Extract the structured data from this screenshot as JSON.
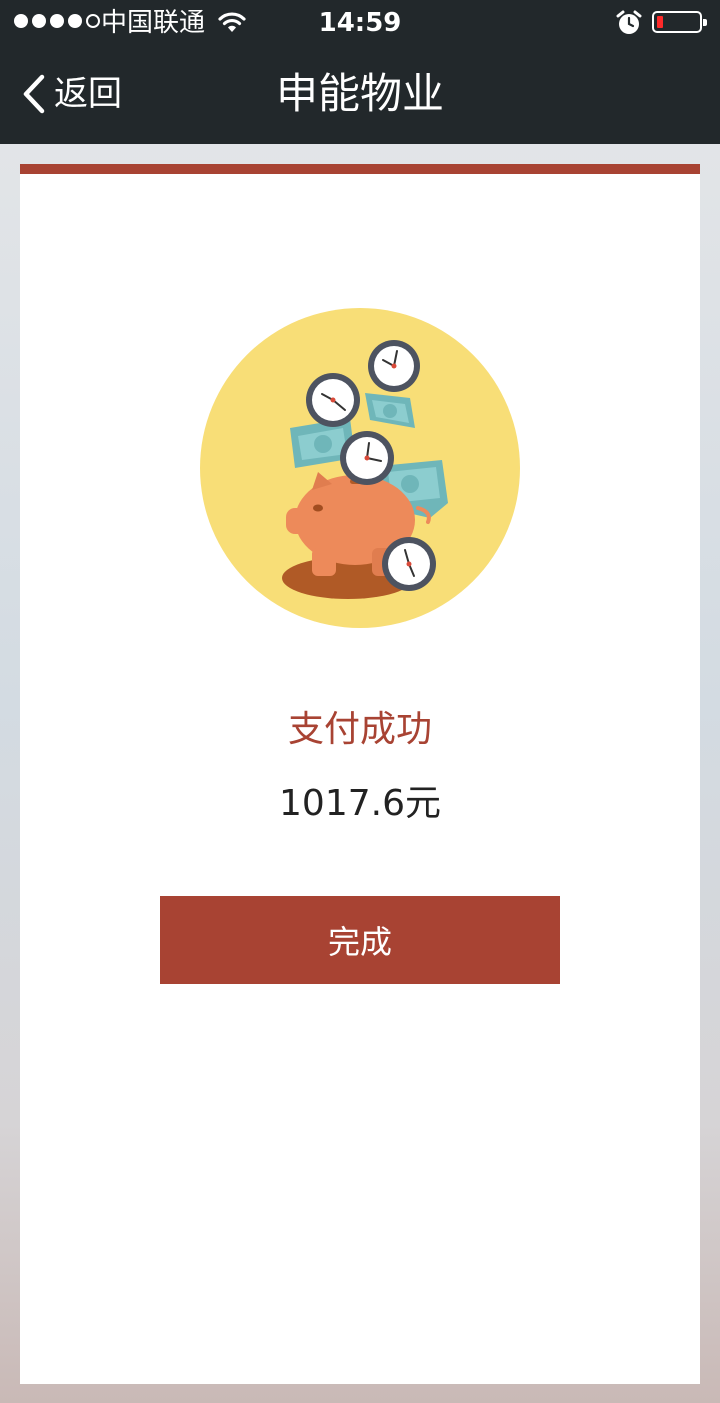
{
  "status_bar": {
    "carrier": "中国联通",
    "time": "14:59",
    "battery_level": 0.1
  },
  "nav": {
    "back_label": "返回",
    "title": "申能物业"
  },
  "payment": {
    "status": "支付成功",
    "amount": "1017.6元",
    "done_label": "完成"
  },
  "colors": {
    "accent": "#a84333",
    "nav_bg": "#22282b",
    "illustration_bg": "#f8de77"
  }
}
